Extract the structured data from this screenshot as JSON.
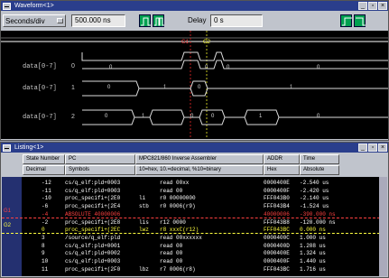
{
  "waveform": {
    "title": "Waveform<1>",
    "timebase_select": "Seconds/div",
    "timebase_value": "500.000 ns",
    "delay_label": "Delay",
    "delay_value": "0 s",
    "markers": [
      "G1",
      "G2"
    ],
    "rows": [
      {
        "label": "data[0-7]",
        "index": "0",
        "values": [
          "0",
          "0",
          "0",
          "0"
        ]
      },
      {
        "label": "data[0-7]",
        "index": "1",
        "values": [
          "0",
          "1",
          "0",
          "1"
        ]
      },
      {
        "label": "data[0-7]",
        "index": "2",
        "values": [
          "0",
          "1",
          "0",
          "0",
          "1",
          "0"
        ]
      }
    ]
  },
  "listing": {
    "title": "Listing<1>",
    "headers": [
      "State Number",
      "PC",
      "MPC821/860 Inverse Assembler",
      "ADDR",
      "Time"
    ],
    "subheaders": [
      "Decimal",
      "Symbols",
      "10=hex, 10.=decimal, %10=binary",
      "Hex",
      "Absolute"
    ],
    "rows": [
      {
        "state": "-12",
        "pc": "cs/q_elf:pld+0003",
        "mn": "",
        "op": "read  00xx",
        "addr": "0000400E",
        "time": "-2.540 us",
        "color": "#fff"
      },
      {
        "state": "-11",
        "pc": "cs/q_elf:pld+0003",
        "mn": "",
        "op": "read  00",
        "addr": "0000400F",
        "time": "-2.420 us",
        "color": "#fff"
      },
      {
        "state": "-10",
        "pc": "proc_specifi+(2E0",
        "mn": "li",
        "op": "r0 00000000",
        "addr": "FFF043B0",
        "time": "-2.140 us",
        "color": "#fff"
      },
      {
        "state": "-6",
        "pc": "proc_specifi+(2E4",
        "mn": "stb",
        "op": "r0 0006(r9)",
        "addr": "FFF043B4",
        "time": "-1.524 us",
        "color": "#fff"
      },
      {
        "state": "-4",
        "pc": "ABSOLUTE 40000006",
        "mn": "",
        "op": "",
        "addr": "40000006",
        "time": "-390.000 ns",
        "color": "#ff4040"
      },
      {
        "state": "-2",
        "pc": "proc_specifi+(2E8",
        "mn": "lis",
        "op": "r12 0000",
        "addr": "FFF043B8",
        "time": "-120.000 ns",
        "color": "#fff"
      },
      {
        "state": "0",
        "pc": "proc_specifi+(2EC",
        "mn": "lwz",
        "op": "r8 xxxC(r12)",
        "addr": "FFF043BC",
        "time": "0.000 ns",
        "color": "#ffff40"
      },
      {
        "state": "3",
        "pc": "/source/q_elf:pld",
        "mn": "",
        "op": "read  00xxxxxx",
        "addr": "0000400C",
        "time": "1.000 us",
        "color": "#fff"
      },
      {
        "state": "8",
        "pc": "cs/q_elf:pld+0001",
        "mn": "",
        "op": "read  00",
        "addr": "0000400D",
        "time": "1.208 us",
        "color": "#fff"
      },
      {
        "state": "9",
        "pc": "cs/q_elf:pld+0002",
        "mn": "",
        "op": "read  00",
        "addr": "0000400E",
        "time": "1.324 us",
        "color": "#fff"
      },
      {
        "state": "10",
        "pc": "cs/q_elf:pld+0003",
        "mn": "",
        "op": "read  00",
        "addr": "0000400F",
        "time": "1.440 us",
        "color": "#fff"
      },
      {
        "state": "11",
        "pc": "proc_specifi+(2F0",
        "mn": "lbz",
        "op": "r7 0006(r8)",
        "addr": "FFF043BC",
        "time": "1.716 us",
        "color": "#fff"
      }
    ],
    "gutter_marks": [
      "G1",
      "G2"
    ]
  }
}
